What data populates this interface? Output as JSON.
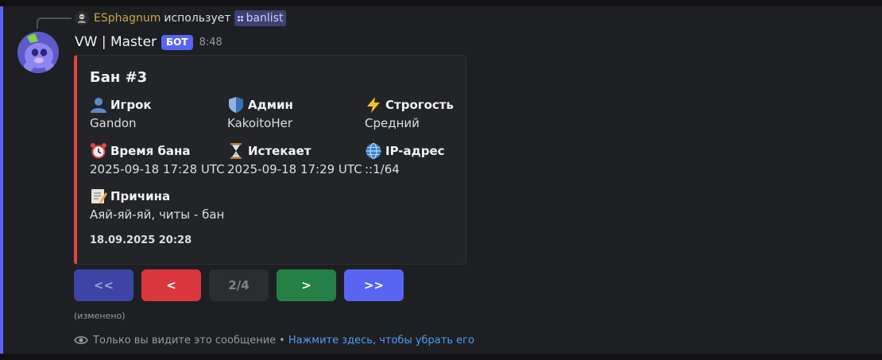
{
  "reply": {
    "author": "ESphagnum",
    "verb": "использует",
    "command": "banlist"
  },
  "message": {
    "author": "VW | Master",
    "bot_tag": "БОТ",
    "time": "8:48"
  },
  "embed": {
    "accent_color": "#e0463f",
    "title": "Бан #3",
    "fields": [
      {
        "icon": "bust-icon",
        "name": "Игрок",
        "value": "Gandon"
      },
      {
        "icon": "shield-icon",
        "name": "Админ",
        "value": "KakoitoHer"
      },
      {
        "icon": "lightning-icon",
        "name": "Строгость",
        "value": "Средний"
      },
      {
        "icon": "alarm-clock-icon",
        "name": "Время бана",
        "value": "2025-09-18 17:28 UTC"
      },
      {
        "icon": "hourglass-icon",
        "name": "Истекает",
        "value": "2025-09-18 17:29 UTC"
      },
      {
        "icon": "globe-icon",
        "name": "IP-адрес",
        "value": "::1/64"
      },
      {
        "icon": "memo-icon",
        "name": "Причина",
        "value": "Аяй-яй-яй, читы - бан"
      }
    ],
    "footer": "18.09.2025 20:28"
  },
  "pagination": {
    "first": {
      "label": "<<",
      "color": "#3c45a5"
    },
    "prev": {
      "label": "<",
      "color": "#da373c"
    },
    "page": {
      "label": "2/4",
      "color": "#2b2d31"
    },
    "next": {
      "label": ">",
      "color": "#248046"
    },
    "last": {
      "label": ">>",
      "color": "#5865f2"
    }
  },
  "edited_label": "(изменено)",
  "ephemeral": {
    "note": "Только вы видите это сообщение",
    "separator": "•",
    "dismiss": "Нажмите здесь, чтобы убрать его"
  }
}
